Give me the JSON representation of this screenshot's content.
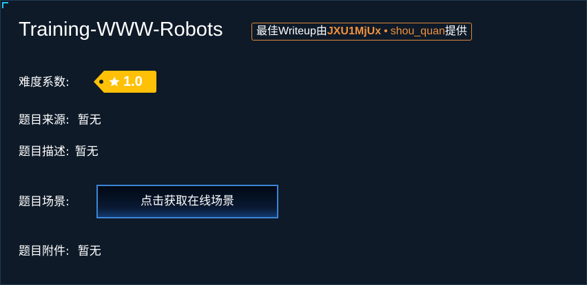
{
  "challenge": {
    "title": "Training-WWW-Robots",
    "writeup": {
      "prefix": "最佳Writeup由",
      "user_main": "JXU1MjUx",
      "separator": "•",
      "user_second": "shou_quan",
      "suffix": "提供"
    }
  },
  "difficulty": {
    "label": "难度系数:",
    "value": "1.0",
    "icon": "star-icon",
    "color": "#ffc107"
  },
  "source": {
    "label": "题目来源:",
    "value": "暂无"
  },
  "description": {
    "label": "题目描述:",
    "value": "暂无"
  },
  "scene": {
    "label": "题目场景:",
    "button_label": "点击获取在线场景"
  },
  "attachment": {
    "label": "题目附件:",
    "value": "暂无"
  },
  "colors": {
    "background": "#0e1a28",
    "accent_orange": "#f2913d",
    "button_border": "#3d86d8",
    "corner": "#1ec8f0"
  }
}
